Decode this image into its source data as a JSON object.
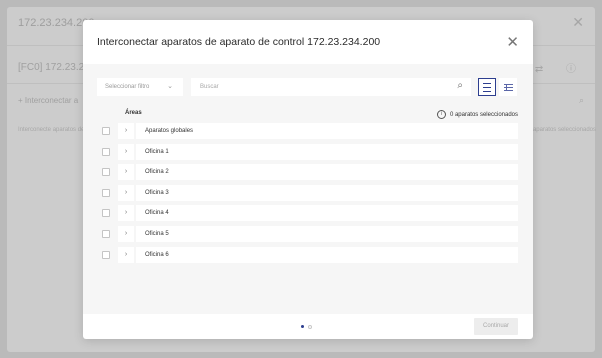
{
  "background": {
    "title": "172.23.234.200",
    "subheader": "[FC0] 172.23.234",
    "add_label": "+ Interconectar a",
    "info_line": "Interconecte aparatos de control aquí",
    "count_text": "0 aparatos seleccionados",
    "close_glyph": "✕",
    "sub_icons": "⇄ ⓘ",
    "search_glyph": "⌕"
  },
  "modal": {
    "title": "Interconectar aparatos de aparato de control 172.23.234.200",
    "close_glyph": "✕",
    "filter": {
      "placeholder": "Seleccionar filtro",
      "chevron": "⌄"
    },
    "search": {
      "placeholder": "Buscar",
      "icon": "search-icon"
    },
    "view": {
      "list_icon": "list-view-icon",
      "grid_icon": "table-view-icon"
    },
    "table": {
      "areas_header": "Áreas",
      "info_glyph": "i",
      "selected_text": "0 aparatos seleccionados",
      "rows": [
        {
          "label": "Aparatos globales",
          "expander": "›"
        },
        {
          "label": "Oficina 1",
          "expander": "›"
        },
        {
          "label": "Oficina 2",
          "expander": "›"
        },
        {
          "label": "Oficina 3",
          "expander": "›"
        },
        {
          "label": "Oficina 4",
          "expander": "›"
        },
        {
          "label": "Oficina 5",
          "expander": "›"
        },
        {
          "label": "Oficina 6",
          "expander": "›"
        }
      ]
    },
    "footer": {
      "step_current": 1,
      "step_total": 2,
      "continue_label": "Continuar"
    }
  },
  "colors": {
    "accent": "#2d3e8f",
    "overlay": "rgba(0,0,0,0.20)",
    "body_bg": "#f6f6f6"
  }
}
